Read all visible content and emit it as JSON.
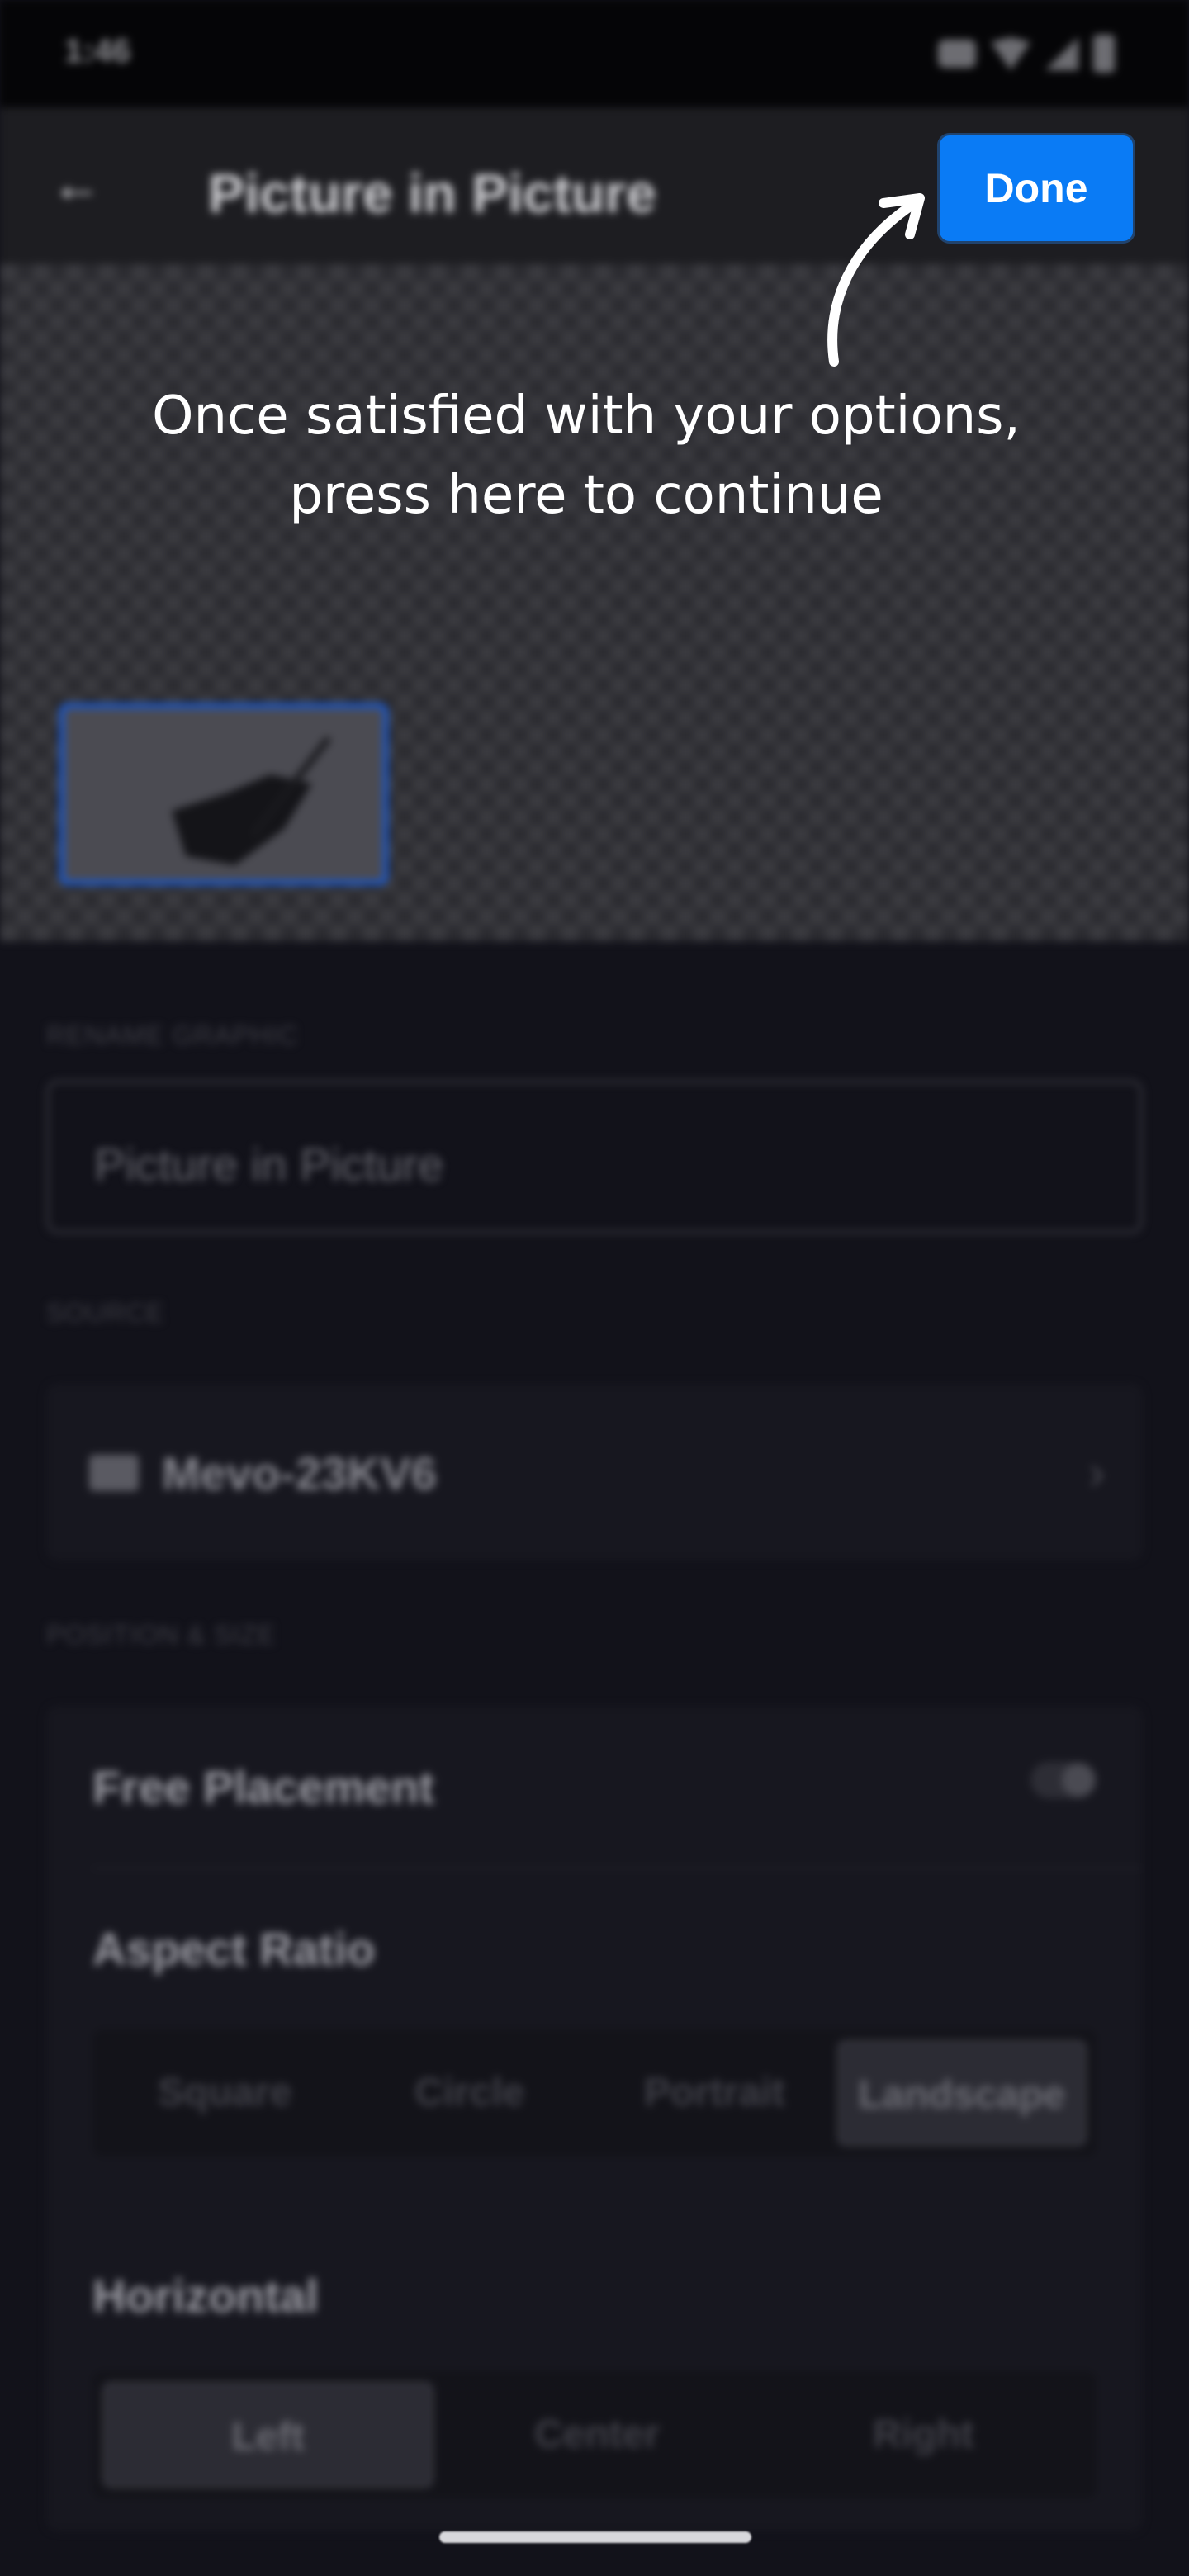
{
  "status_bar": {
    "time": "1:46"
  },
  "app_bar": {
    "title": "Picture in Picture",
    "done_label": "Done"
  },
  "tutorial": {
    "hint": "Once satisfied with your options,\npress here to continue"
  },
  "rename": {
    "label": "RENAME GRAPHIC",
    "value": "Picture in Picture"
  },
  "source": {
    "label": "SOURCE",
    "name": "Mevo-23KV6"
  },
  "position": {
    "label": "POSITION & SIZE",
    "free_placement": "Free Placement",
    "free_placement_on": false,
    "aspect_ratio_label": "Aspect Ratio",
    "aspect_ratio_options": [
      "Square",
      "Circle",
      "Portrait",
      "Landscape"
    ],
    "aspect_ratio_selected": "Landscape",
    "horizontal_label": "Horizontal",
    "horizontal_options": [
      "Left",
      "Center",
      "Right"
    ],
    "horizontal_selected": "Left"
  },
  "colors": {
    "accent": "#0a7bf5",
    "background": "#12121a",
    "selection_border": "#1558d6"
  }
}
